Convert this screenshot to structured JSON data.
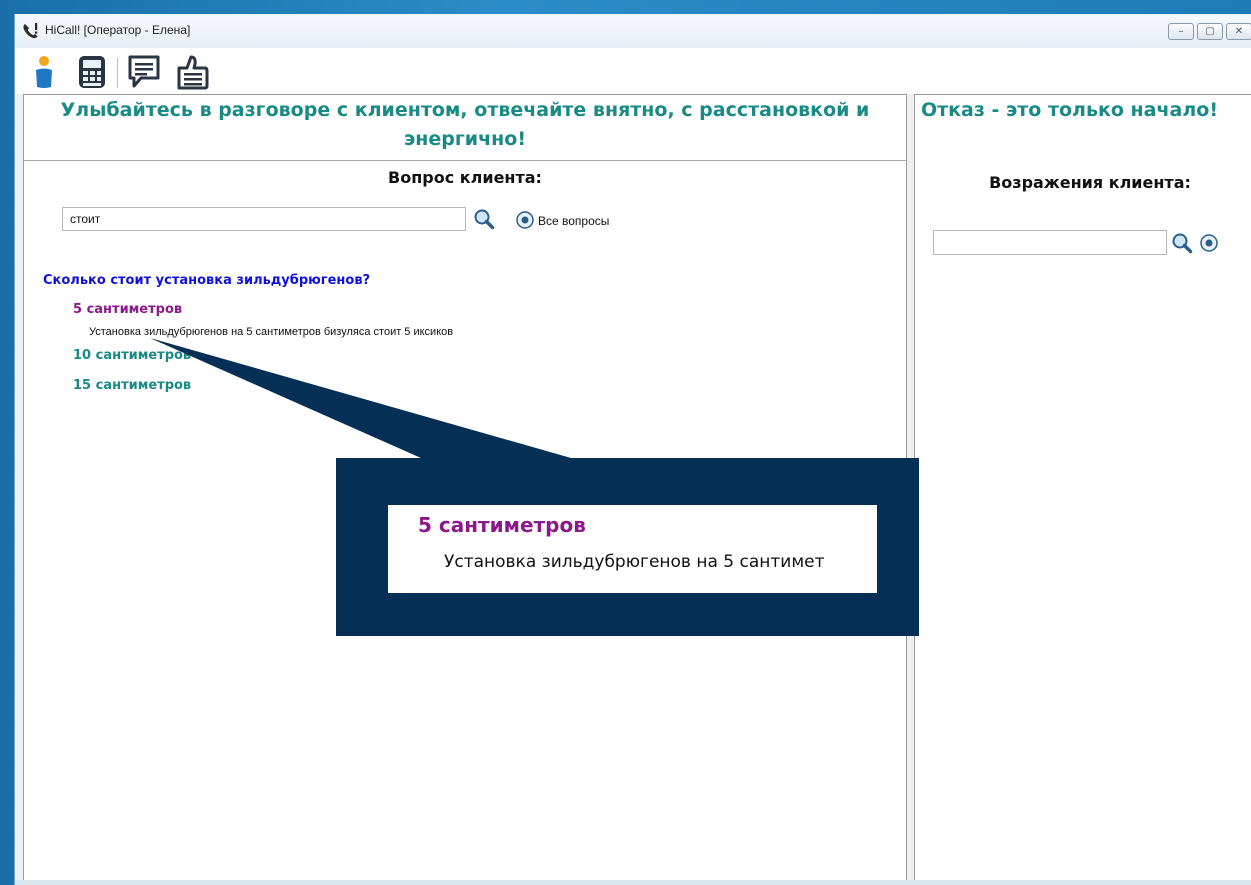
{
  "window": {
    "title": "HiCall!  [Оператор - Елена]",
    "controls": {
      "minimize": "–",
      "maximize": "▢",
      "close": "✕"
    }
  },
  "toolbar": {
    "icons": [
      "operator-icon",
      "calculator-icon",
      "chat-icon",
      "like-icon"
    ]
  },
  "left_panel": {
    "motto": "Улыбайтесь в разговоре с клиентом, отвечайте внятно, с расстановкой и энергично!",
    "question_header": "Вопрос клиента:",
    "search": {
      "value": "стоит"
    },
    "all_questions_label": "Все вопросы",
    "question": "Сколько стоит установка зильдубрюгенов?",
    "answers": [
      {
        "label": "5 сантиметров",
        "expanded": true,
        "text": "Установка зильдубрюгенов на 5 сантиметров бизуляса стоит 5 иксиков"
      },
      {
        "label": "10 сантиметров",
        "expanded": false
      },
      {
        "label": "15 сантиметров",
        "expanded": false
      }
    ]
  },
  "right_panel": {
    "motto": "Отказ - это только начало!",
    "objections_header": "Возражения клиента:",
    "search": {
      "value": ""
    }
  },
  "callout": {
    "answer_label": "5 сантиметров",
    "answer_text": "Установка зильдубрюгенов на 5 сантимет"
  },
  "colors": {
    "teal": "#1a8a84",
    "purple": "#8a1a8a",
    "blue_link": "#1010dd",
    "callout_navy": "#052f55"
  }
}
